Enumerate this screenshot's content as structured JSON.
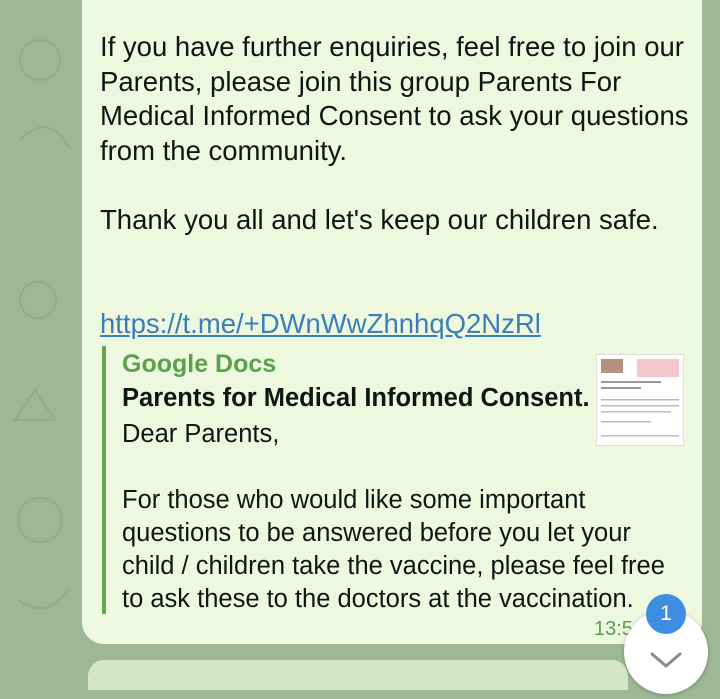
{
  "message": {
    "paragraph1": "If you have further enquiries, feel free to join our Parents, please join this group Parents For Medical Informed Consent to ask your questions from the community.",
    "paragraph2": "Thank you all and let's keep our children safe.",
    "link": "https://t.me/+DWnWwZhnhqQ2NzRl",
    "time": "13:5"
  },
  "preview": {
    "site": "Google Docs",
    "title": "Parents for Medical Informed Consent.",
    "body": "Dear Parents,\n\nFor those who would like some important questions to be answered before you let your child / children take the vaccine, please feel free to ask these to the doctors at the vaccination."
  },
  "badge_count": "1",
  "colors": {
    "link": "#3a7fb8",
    "accent": "#5aa24a",
    "bubble": "#eef8df",
    "badge": "#3d8ee0"
  },
  "icons": {
    "scroll": "chevron-down-icon"
  }
}
